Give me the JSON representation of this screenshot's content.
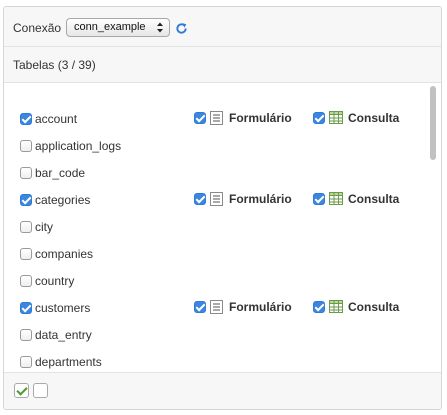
{
  "connection": {
    "label": "Conexão",
    "selected": "conn_example",
    "refresh_icon": "refresh-icon"
  },
  "tables_header": "Tabelas (3 / 39)",
  "form_label": "Formulário",
  "query_label": "Consulta",
  "tables": [
    {
      "name": "account",
      "selected": true,
      "form": true,
      "query": true
    },
    {
      "name": "application_logs",
      "selected": false
    },
    {
      "name": "bar_code",
      "selected": false
    },
    {
      "name": "categories",
      "selected": true,
      "form": true,
      "query": true
    },
    {
      "name": "city",
      "selected": false
    },
    {
      "name": "companies",
      "selected": false
    },
    {
      "name": "country",
      "selected": false
    },
    {
      "name": "customers",
      "selected": true,
      "form": true,
      "query": true
    },
    {
      "name": "data_entry",
      "selected": false
    },
    {
      "name": "departments",
      "selected": false
    }
  ],
  "footer": {
    "select_all_icon": "check-icon",
    "select_none_icon": "empty-box-icon"
  },
  "colors": {
    "checkbox_checked": "#3b86e0",
    "panel_header_bg": "#f7f7f7",
    "border": "#d6d6d6",
    "check_green": "#4a9a2a"
  }
}
